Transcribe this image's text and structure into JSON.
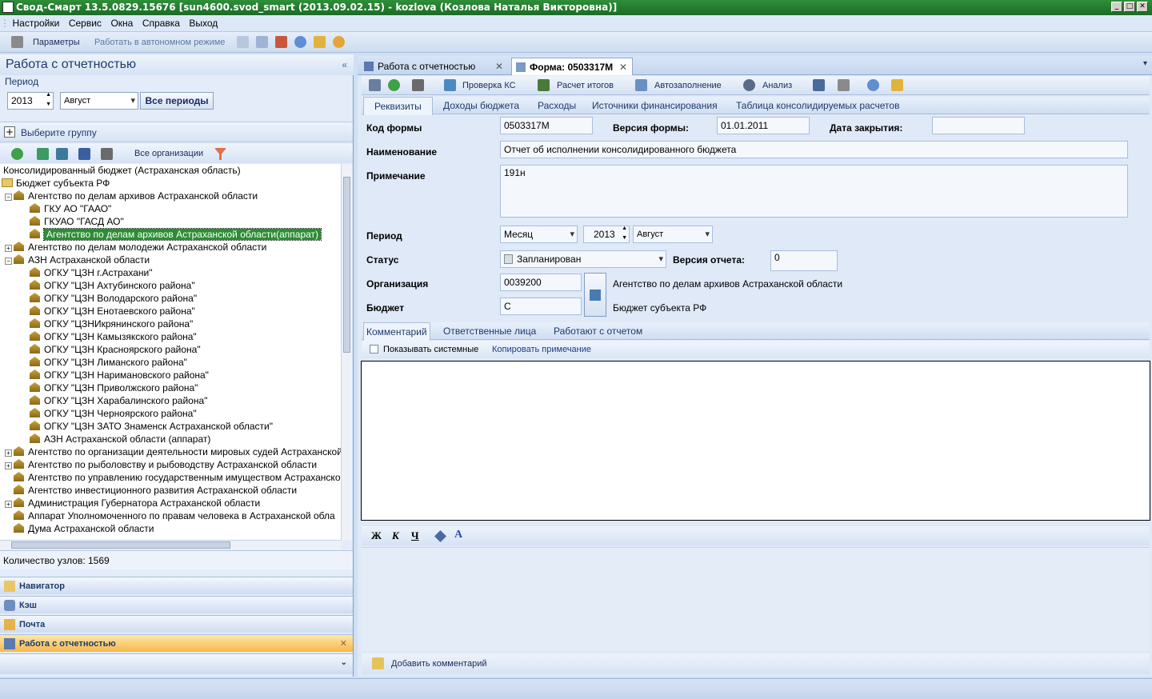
{
  "window": {
    "title": "Свод-Смарт 13.5.0829.15676 [sun4600.svod_smart (2013.09.02.15) - kozlova (Козлова Наталья Викторовна)]"
  },
  "menu": [
    "Настройки",
    "Сервис",
    "Окна",
    "Справка",
    "Выход"
  ],
  "toolbar": {
    "params": "Параметры",
    "offline": "Работать в автономном режиме"
  },
  "left": {
    "title": "Работа с отчетностью",
    "period_label": "Период",
    "year": "2013",
    "month": "Август",
    "all_periods": "Все периоды",
    "select_group": "Выберите группу",
    "all_orgs": "Все организации",
    "tree": [
      {
        "text": "Консолидированный бюджет (Астраханская область)",
        "level": 0,
        "type": "root"
      },
      {
        "text": "Бюджет субъекта РФ",
        "level": 0,
        "type": "folder"
      },
      {
        "text": "Агентство по делам архивов Астраханской области",
        "level": 1,
        "type": "org",
        "exp": "−"
      },
      {
        "text": "ГКУ АО \"ГААО\"",
        "level": 2,
        "type": "org"
      },
      {
        "text": "ГКУАО \"ГАСД АО\"",
        "level": 2,
        "type": "org"
      },
      {
        "text": "Агентство по делам архивов Астраханской области(аппарат)",
        "level": 2,
        "type": "org",
        "selected": true
      },
      {
        "text": "Агентство по делам молодежи Астраханской области",
        "level": 1,
        "type": "org",
        "exp": "+"
      },
      {
        "text": "АЗН Астраханской области",
        "level": 1,
        "type": "org",
        "exp": "−"
      },
      {
        "text": "ОГКУ \"ЦЗН г.Астрахани\"",
        "level": 2,
        "type": "org"
      },
      {
        "text": "ОГКУ \"ЦЗН Ахтубинского района\"",
        "level": 2,
        "type": "org"
      },
      {
        "text": "ОГКУ \"ЦЗН Володарского района\"",
        "level": 2,
        "type": "org"
      },
      {
        "text": "ОГКУ \"ЦЗН Енотаевского района\"",
        "level": 2,
        "type": "org"
      },
      {
        "text": "ОГКУ \"ЦЗНИкрянинского района\"",
        "level": 2,
        "type": "org"
      },
      {
        "text": "ОГКУ \"ЦЗН Камызякского района\"",
        "level": 2,
        "type": "org"
      },
      {
        "text": "ОГКУ \"ЦЗН Красноярского района\"",
        "level": 2,
        "type": "org"
      },
      {
        "text": "ОГКУ \"ЦЗН Лиманского района\"",
        "level": 2,
        "type": "org"
      },
      {
        "text": "ОГКУ \"ЦЗН Наримановского района\"",
        "level": 2,
        "type": "org"
      },
      {
        "text": "ОГКУ \"ЦЗН Приволжского района\"",
        "level": 2,
        "type": "org"
      },
      {
        "text": "ОГКУ \"ЦЗН Харабалинского района\"",
        "level": 2,
        "type": "org"
      },
      {
        "text": "ОГКУ \"ЦЗН Черноярского района\"",
        "level": 2,
        "type": "org"
      },
      {
        "text": "ОГКУ \"ЦЗН ЗАТО Знаменск Астраханской области\"",
        "level": 2,
        "type": "org"
      },
      {
        "text": "АЗН Астраханской области (аппарат)",
        "level": 2,
        "type": "org"
      },
      {
        "text": "Агентство по организации деятельности мировых судей Астраханской",
        "level": 1,
        "type": "org",
        "exp": "+"
      },
      {
        "text": "Агентство по рыболовству и рыбоводству Астраханской области",
        "level": 1,
        "type": "org",
        "exp": "+"
      },
      {
        "text": "Агентство по управлению государственным имуществом Астраханской",
        "level": 1,
        "type": "org"
      },
      {
        "text": "Агентство инвестиционного развития Астраханской области",
        "level": 1,
        "type": "org"
      },
      {
        "text": "Администрация Губернатора Астраханской области",
        "level": 1,
        "type": "org",
        "exp": "+"
      },
      {
        "text": "Аппарат Уполномоченного по правам человека в Астраханской обла",
        "level": 1,
        "type": "org"
      },
      {
        "text": "Дума Астраханской области",
        "level": 1,
        "type": "org"
      }
    ],
    "node_count": "Количество узлов: 1569",
    "nav": [
      "Навигатор",
      "Кэш",
      "Почта",
      "Работа с отчетностью"
    ]
  },
  "right": {
    "doc_tabs": [
      "Работа с отчетностью",
      "Форма: 0503317М"
    ],
    "form_toolbar": [
      "Проверка КС",
      "Расчет итогов",
      "Автозаполнение",
      "Анализ"
    ],
    "subtabs": [
      "Реквизиты",
      "Доходы бюджета",
      "Расходы",
      "Источники финансирования",
      "Таблица консолидируемых расчетов"
    ],
    "fields": {
      "form_code_label": "Код формы",
      "form_code": "0503317М",
      "form_version_label": "Версия формы:",
      "form_version": "01.01.2011",
      "close_date_label": "Дата закрытия:",
      "close_date": "",
      "name_label": "Наименование",
      "name": "Отчет об исполнении консолидированного бюджета",
      "note_label": "Примечание",
      "note": "191н",
      "period_label": "Период",
      "period_type": "Месяц",
      "period_year": "2013",
      "period_month": "Август",
      "status_label": "Статус",
      "status": "Запланирован",
      "report_version_label": "Версия отчета:",
      "report_version": "0",
      "org_label": "Организация",
      "org_code": "0039200",
      "org_name": "Агентство по делам архивов Астраханской области",
      "budget_label": "Бюджет",
      "budget_code": "С",
      "budget_name": "Бюджет субъекта РФ"
    },
    "comment_tabs": [
      "Комментарий",
      "Ответственные лица",
      "Работают с отчетом"
    ],
    "show_system": "Показывать системные",
    "copy_note": "Копировать примечание",
    "fmt": [
      "Ж",
      "К",
      "Ч",
      "A"
    ],
    "add_comment": "Добавить комментарий"
  }
}
